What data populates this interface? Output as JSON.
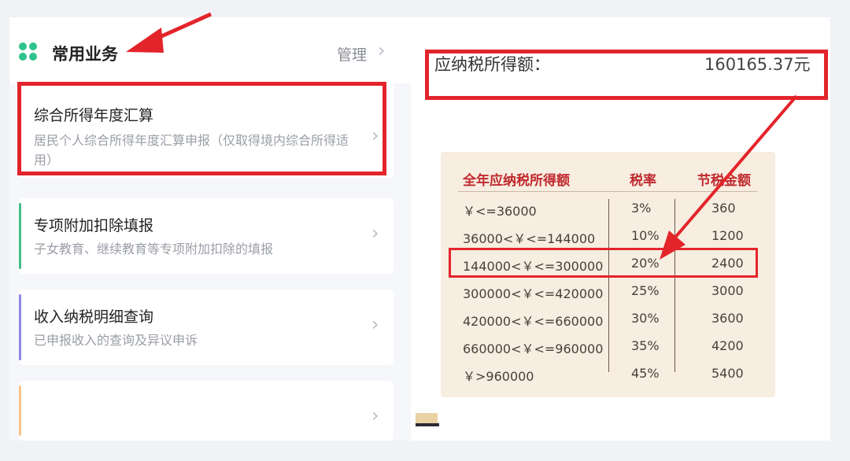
{
  "left_panel": {
    "section_title": "常用业务",
    "manage_label": "管理",
    "chevron": "›",
    "cards": [
      {
        "title": "综合所得年度汇算",
        "subtitle": "居民个人综合所得年度汇算申报（仅取得境内综合所得适用）"
      },
      {
        "title": "专项附加扣除填报",
        "subtitle": "子女教育、继续教育等专项附加扣除的填报"
      },
      {
        "title": "收入纳税明细查询",
        "subtitle": "已申报收入的查询及异议申诉"
      }
    ],
    "card_accent_colors": [
      "#f0a9a9",
      "#42c08a",
      "#8f86e3",
      "#f5c48c"
    ]
  },
  "right_panel": {
    "taxable_label": "应纳税所得额：",
    "taxable_value": "160165.37元",
    "table": {
      "headers": [
        "全年应纳税所得额",
        "税率",
        "节税金额"
      ],
      "rows": [
        [
          "￥<=36000",
          "3%",
          "360"
        ],
        [
          "36000<￥<=144000",
          "10%",
          "1200"
        ],
        [
          "144000<￥<=300000",
          "20%",
          "2400"
        ],
        [
          "300000<￥<=420000",
          "25%",
          "3000"
        ],
        [
          "420000<￥<=660000",
          "30%",
          "3600"
        ],
        [
          "660000<￥<=960000",
          "35%",
          "4200"
        ],
        [
          "￥>960000",
          "45%",
          "5400"
        ]
      ],
      "highlighted_row": 2
    }
  },
  "colors": {
    "highlight_red": "#e3242b",
    "logo_green": "#2ec38b",
    "header_red": "#c0282d"
  }
}
